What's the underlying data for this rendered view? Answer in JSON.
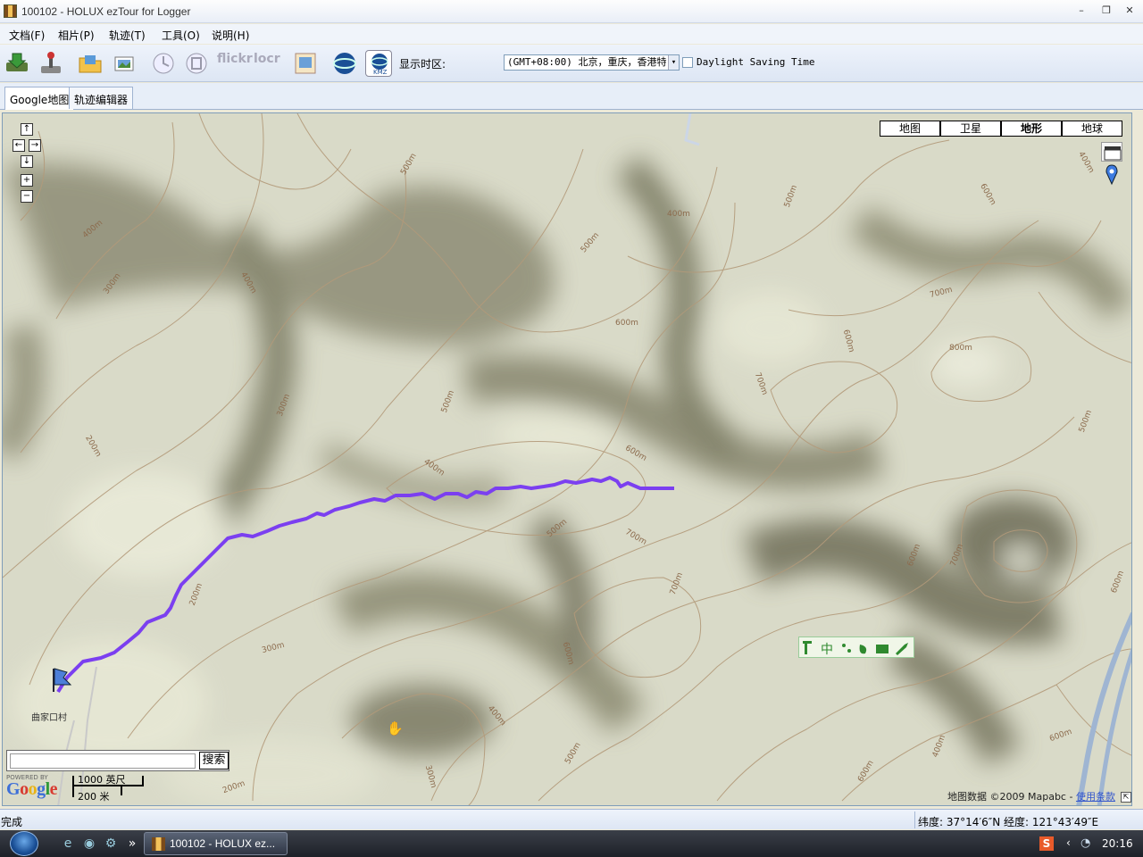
{
  "window": {
    "title": "100102 - HOLUX ezTour for Logger",
    "min": "–",
    "max": "❐",
    "close": "✕"
  },
  "menu": [
    "文档(F)",
    "相片(P)",
    "轨迹(T)",
    "工具(O)",
    "说明(H)"
  ],
  "toolbar": {
    "tz_label": "显示时区:",
    "tz_value": "(GMT+08:00) 北京，重庆，香港特",
    "dst_checked": false,
    "dst_label": "Daylight Saving Time",
    "icons": [
      "download-logger-icon",
      "joystick-icon",
      "open-folder-icon",
      "photos-icon",
      "clock-icon",
      "trash-icon",
      "flickr-icon",
      "locr-icon",
      "photo-album-icon",
      "google-earth-icon",
      "kmz-icon"
    ],
    "flickr_text": "flickr",
    "locr_text": "locr",
    "kmz_text": "KMZ"
  },
  "tabs": [
    "Google地图",
    "轨迹编辑器"
  ],
  "active_tab": "Google地图",
  "map": {
    "map_types": [
      "地图",
      "卫星",
      "地形",
      "地球"
    ],
    "active_type": "地形",
    "nav": {
      "up": "↑",
      "left": "←",
      "right": "→",
      "down": "↓",
      "zoom_in": "+",
      "zoom_out": "−"
    },
    "contour_labels": [
      "500m",
      "400m",
      "500m",
      "600m",
      "400m",
      "400m",
      "300m",
      "400m",
      "500m",
      "700m",
      "600m",
      "600m",
      "800m",
      "700m",
      "300m",
      "500m",
      "600m",
      "200m",
      "400m",
      "500m",
      "600m",
      "700m",
      "600m",
      "700m",
      "200m",
      "300m",
      "600m",
      "400m",
      "500m",
      "600m",
      "300m",
      "200m",
      "600m",
      "400m",
      "700m",
      "500m"
    ],
    "place_label": "曲家口村",
    "search_button": "搜索",
    "search_value": "",
    "powered_by": "POWERED BY",
    "google_logo": "Google",
    "scale_top": "1000 英尺",
    "scale_bottom": "200 米",
    "copyright": "地图数据 ©2009 Mapabc -",
    "terms_link": "使用条款",
    "track_color": "#7b3ff0"
  },
  "status": {
    "left": "完成",
    "coords": "纬度: 37°14′6″N  经度: 121°43′49″E"
  },
  "taskbar": {
    "active_window": "100102 - HOLUX ez...",
    "clock": "20:16",
    "overflow": "»"
  }
}
